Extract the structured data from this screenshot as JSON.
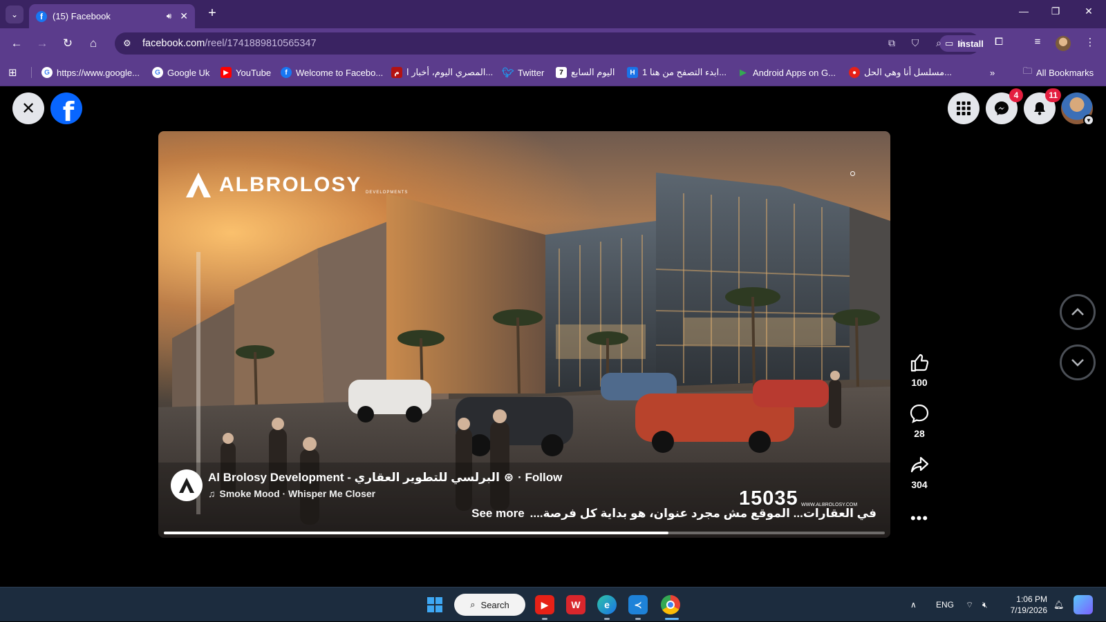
{
  "browser": {
    "tab_title": "(15) Facebook",
    "url_host": "facebook.com",
    "url_path": "/reel/1741889810565347",
    "install_label": "Install",
    "bookmarks": [
      {
        "label": "https://www.google...",
        "icon": "google-icon"
      },
      {
        "label": "Google Uk",
        "icon": "google-icon"
      },
      {
        "label": "YouTube",
        "icon": "youtube-icon"
      },
      {
        "label": "Welcome to Facebo...",
        "icon": "facebook-icon"
      },
      {
        "label": "المصري اليوم، أخبار ا...",
        "icon": "masry-icon"
      },
      {
        "label": "Twitter",
        "icon": "twitter-icon"
      },
      {
        "label": "اليوم السابع",
        "icon": "youm7-icon"
      },
      {
        "label": "ابدء التصفح من هنا 1...",
        "icon": "h-icon"
      },
      {
        "label": "Android Apps on G...",
        "icon": "play-icon"
      },
      {
        "label": "مسلسل أنا وهي الحل...",
        "icon": "red-icon"
      }
    ],
    "all_bookmarks_label": "All Bookmarks"
  },
  "facebook": {
    "messenger_badge": "4",
    "notifications_badge": "11"
  },
  "reel": {
    "brand_name": "ALBROLOSY",
    "brand_sub": "DEVELOPMENTS",
    "page_name": "Al Brolosy Development - البرلسي للتطوير العقاري",
    "follow_label": "· Follow",
    "music": "Smoke Mood · Whisper Me Closer",
    "counter": "15035",
    "counter_url": "WWW.ALBROLOSY.COM",
    "caption": "في العقارات... الموقع مش مجرد عنوان، هو بداية كل فرصة....",
    "see_more_label": "See more",
    "progress_fraction": 0.7,
    "likes": "100",
    "comments": "28",
    "shares": "304"
  },
  "taskbar": {
    "search_label": "Search",
    "language": "ENG",
    "time": "1:06 PM",
    "date": "7/19/2026"
  },
  "colors": {
    "chrome_dark": "#3a2362",
    "chrome_light": "#5b3c8c",
    "facebook_blue": "#0866ff",
    "badge_red": "#e41e3f"
  }
}
